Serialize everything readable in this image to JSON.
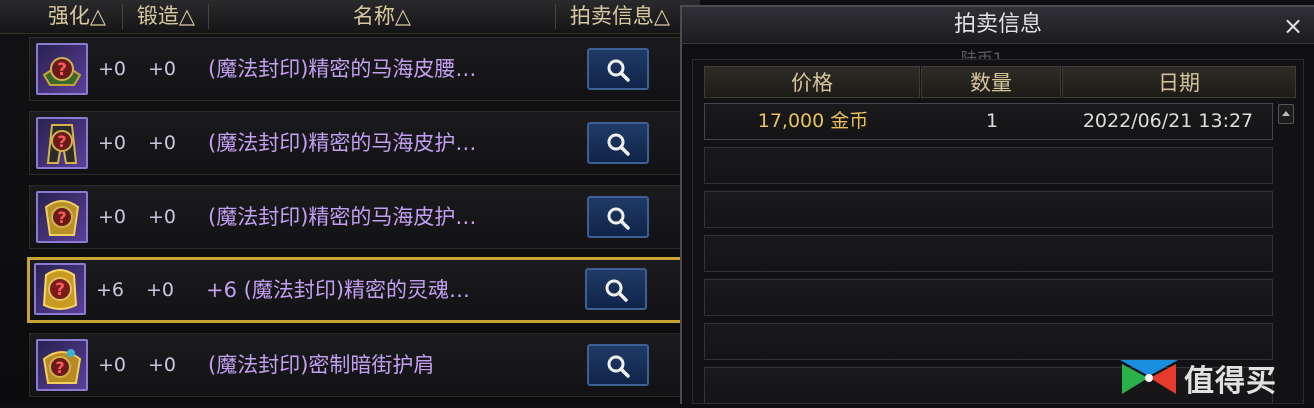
{
  "list": {
    "columns": [
      {
        "label": "强化△",
        "key": "enhance"
      },
      {
        "label": "锻造△",
        "key": "forge"
      },
      {
        "label": "名称△",
        "key": "name"
      },
      {
        "label": "拍卖信息△",
        "key": "auction"
      }
    ],
    "items": [
      {
        "enhance": "+0",
        "forge": "+0",
        "name": "(魔法封印)精密的马海皮腰…",
        "icon": "belt-icon",
        "selected": false
      },
      {
        "enhance": "+0",
        "forge": "+0",
        "name": "(魔法封印)精密的马海皮护…",
        "icon": "pants-icon",
        "selected": false
      },
      {
        "enhance": "+0",
        "forge": "+0",
        "name": "(魔法封印)精密的马海皮护…",
        "icon": "shoulder-icon",
        "selected": false
      },
      {
        "enhance": "+6",
        "forge": "+0",
        "name": "+6 (魔法封印)精密的灵魂…",
        "icon": "soul-armor-icon",
        "selected": true
      },
      {
        "enhance": "+0",
        "forge": "+0",
        "name": "(魔法封印)密制暗街护肩",
        "icon": "shoulder-guard-icon",
        "selected": false
      }
    ],
    "search_icon": "magnifier-icon"
  },
  "auction_popup": {
    "title": "拍卖信息",
    "close_label": "×",
    "background_ghost_text": "陆币1",
    "columns": [
      "价格",
      "数量",
      "日期"
    ],
    "rows": [
      {
        "price": "17,000 金币",
        "quantity": "1",
        "date": "2022/06/21 13:27"
      },
      {
        "price": "",
        "quantity": "",
        "date": ""
      },
      {
        "price": "",
        "quantity": "",
        "date": ""
      },
      {
        "price": "",
        "quantity": "",
        "date": ""
      },
      {
        "price": "",
        "quantity": "",
        "date": ""
      },
      {
        "price": "",
        "quantity": "",
        "date": ""
      },
      {
        "price": "",
        "quantity": "",
        "date": ""
      }
    ]
  },
  "watermark": {
    "text": "值得买",
    "icon": "smzdm-logo-icon"
  },
  "colors": {
    "item_name": "#c39ff2",
    "price_gold": "#e7c15a",
    "selected_border": "#c8a532",
    "header_text": "#d8c9a0",
    "search_button": "#1f3b66"
  }
}
